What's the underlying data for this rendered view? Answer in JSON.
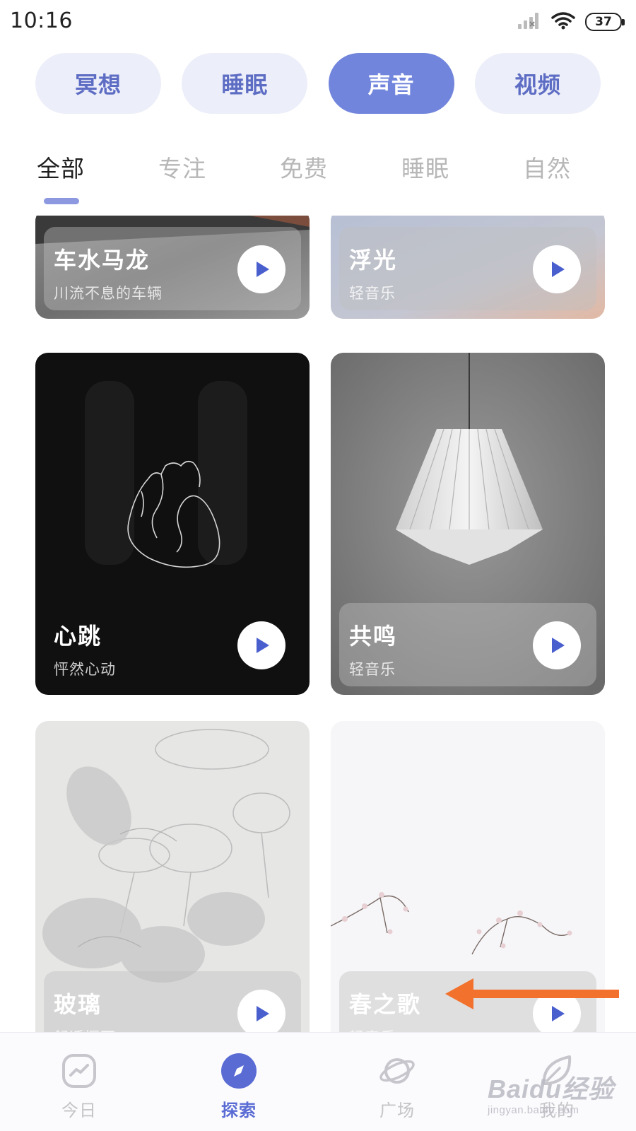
{
  "status_bar": {
    "time": "10:16",
    "battery": "37",
    "icons": [
      "signal-icon",
      "wifi-icon",
      "battery-icon"
    ]
  },
  "categories": [
    {
      "label": "冥想",
      "active": false
    },
    {
      "label": "睡眠",
      "active": false
    },
    {
      "label": "声音",
      "active": true
    },
    {
      "label": "视频",
      "active": false
    }
  ],
  "sub_tabs": [
    {
      "label": "全部",
      "active": true
    },
    {
      "label": "专注",
      "active": false
    },
    {
      "label": "免费",
      "active": false
    },
    {
      "label": "睡眠",
      "active": false
    },
    {
      "label": "自然",
      "active": false
    }
  ],
  "cards": [
    {
      "title": "车水马龙",
      "subtitle": "川流不息的车辆",
      "icon": "play-icon"
    },
    {
      "title": "浮光",
      "subtitle": "轻音乐",
      "icon": "play-icon"
    },
    {
      "title": "心跳",
      "subtitle": "怦然心动",
      "icon": "play-icon"
    },
    {
      "title": "共鸣",
      "subtitle": "轻音乐",
      "icon": "play-icon"
    },
    {
      "title": "玻璃",
      "subtitle": "舒适惬耳",
      "icon": "play-icon"
    },
    {
      "title": "春之歌",
      "subtitle": "轻音乐",
      "icon": "play-icon"
    }
  ],
  "bottom_nav": [
    {
      "label": "今日",
      "icon": "trend-icon",
      "active": false
    },
    {
      "label": "探索",
      "icon": "compass-icon",
      "active": true
    },
    {
      "label": "广场",
      "icon": "planet-icon",
      "active": false
    },
    {
      "label": "我的",
      "icon": "leaf-icon",
      "active": false
    }
  ],
  "colors": {
    "accent": "#7185dc",
    "accent_dark": "#5a6cd4",
    "pill_bg": "#eceef9",
    "annotation_arrow": "#f2712c"
  },
  "watermark": {
    "main": "Baidu经验",
    "sub": "jingyan.baidu.com"
  }
}
